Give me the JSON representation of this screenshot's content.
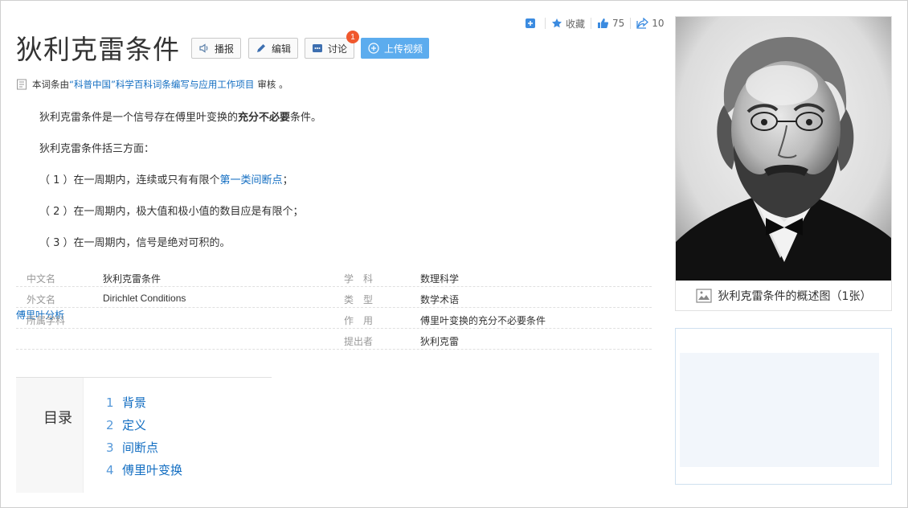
{
  "header": {
    "title": "狄利克雷条件",
    "buttons": {
      "broadcast": "播报",
      "edit": "编辑",
      "discuss": "讨论",
      "upload_video": "上传视频"
    },
    "discuss_badge": "1"
  },
  "stats": {
    "favorite_label": "收藏",
    "likes": "75",
    "shares": "10"
  },
  "review": {
    "prefix": "本词条由",
    "org": "“科普中国”科学百科词条编写与应用工作项目",
    "suffix": "审核 。"
  },
  "summary": {
    "line1_a": "狄利克雷条件是一个信号存在傅里叶变换的",
    "line1_bold": "充分不必要",
    "line1_b": "条件。",
    "line2": "狄利克雷条件括三方面：",
    "line3_a": "（ 1 ）在一周期内，连续或只有有限个",
    "line3_link": "第一类间断点",
    "line3_b": "；",
    "line4": "（ 2 ）在一周期内，极大值和极小值的数目应是有限个；",
    "line5": "（ 3 ）在一周期内，信号是绝对可积的。"
  },
  "info": {
    "rows": [
      {
        "k1": "中文名",
        "v1": "狄利克雷条件",
        "k2": "学　科",
        "v2": "数理科学"
      },
      {
        "k1": "外文名",
        "v1": "Dirichlet Conditions",
        "k2": "类　型",
        "v2": "数学术语"
      },
      {
        "k1": "所属学科",
        "v1": "傅里叶分析",
        "k2": "作　用",
        "v2": "傅里叶变换的充分不必要条件"
      },
      {
        "k1": "",
        "v1": "",
        "k2": "提出者",
        "v2": "狄利克雷"
      }
    ]
  },
  "catalog": {
    "title": "目录",
    "items": [
      {
        "num": "1",
        "text": "背景"
      },
      {
        "num": "2",
        "text": "定义"
      },
      {
        "num": "3",
        "text": "间断点"
      },
      {
        "num": "4",
        "text": "傅里叶变换"
      }
    ]
  },
  "sidebar": {
    "picture_caption": "狄利克雷条件的概述图（1张）"
  },
  "colors": {
    "link": "#136ec2",
    "primary_button": "#5cacee",
    "badge": "#f0582d"
  }
}
